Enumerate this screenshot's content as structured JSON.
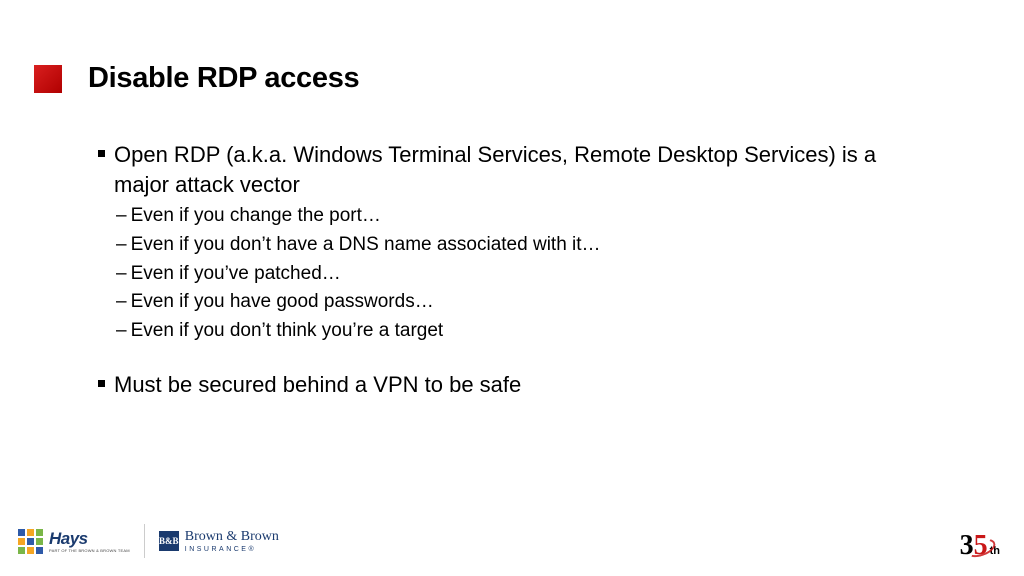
{
  "title": "Disable RDP access",
  "bullets": [
    {
      "text": "Open RDP (a.k.a. Windows Terminal Services, Remote Desktop Services) is a major attack vector",
      "sub": [
        "Even if you change the port…",
        "Even if you don’t have a DNS name associated with it…",
        "Even if you’ve patched…",
        "Even if you have good passwords…",
        "Even if you don’t think you’re a target"
      ]
    },
    {
      "text": "Must be secured behind a VPN to be safe",
      "sub": []
    }
  ],
  "footer": {
    "hays": {
      "name": "Hays",
      "tagline": "PART OF THE BROWN & BROWN TEAM"
    },
    "brownbrown": {
      "mono": "B&B",
      "name": "Brown & Brown",
      "sub": "INSURANCE®"
    },
    "anniversary": {
      "three": "3",
      "five": "5",
      "suffix": "th"
    }
  },
  "colors": {
    "haysGrid": [
      "#2e5aa8",
      "#f5a623",
      "#7ab648",
      "#f5a623",
      "#2e5aa8",
      "#7ab648",
      "#7ab648",
      "#f5a623",
      "#2e5aa8"
    ]
  }
}
